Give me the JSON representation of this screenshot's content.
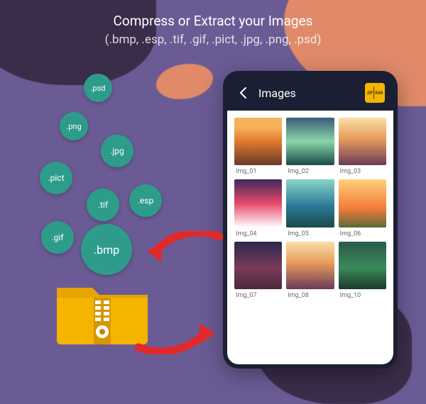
{
  "headline": "Compress or Extract your Images",
  "subheadline": "(.bmp, .esp, .tif, .gif, .pict, .jpg, .png, .psd)",
  "bubbles": {
    "psd": ".psd",
    "png": ".png",
    "jpg": ".jpg",
    "pict": ".pict",
    "tif": ".tif",
    "esp": ".esp",
    "gif": ".gif",
    "bmp": ".bmp"
  },
  "phone": {
    "title": "Images",
    "app_icon_left": "ZIP",
    "app_icon_right": "RAR",
    "thumbs": [
      {
        "label": "Img_01"
      },
      {
        "label": "Img_02"
      },
      {
        "label": "Img_03"
      },
      {
        "label": "Img_04"
      },
      {
        "label": "Img_05"
      },
      {
        "label": "Img_06"
      },
      {
        "label": "Img_07"
      },
      {
        "label": "Img_08"
      },
      {
        "label": "Img_10"
      }
    ]
  },
  "colors": {
    "accent_bubble": "#2e9c8a",
    "folder": "#f4b400",
    "arrow": "#e02a2a",
    "bg": "#6b5b95"
  }
}
